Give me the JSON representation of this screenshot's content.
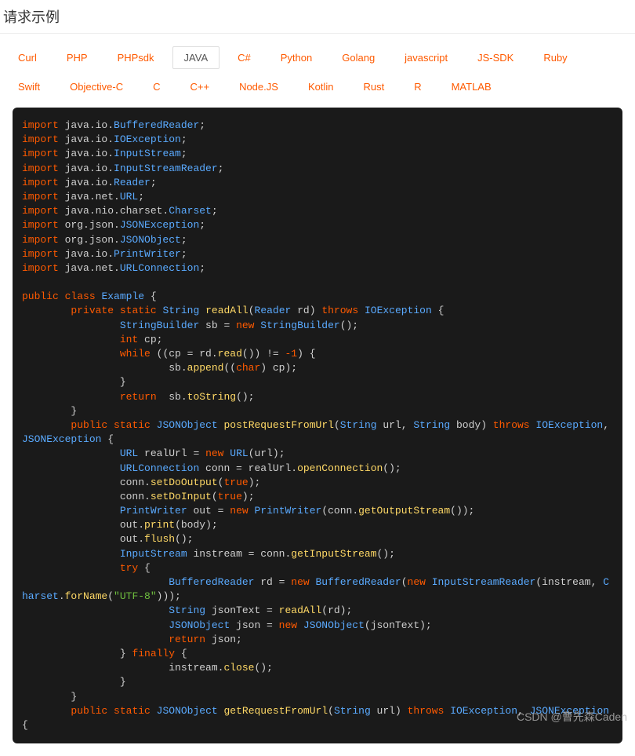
{
  "header": {
    "title": "请求示例"
  },
  "tabs": {
    "items": [
      {
        "label": "Curl"
      },
      {
        "label": "PHP"
      },
      {
        "label": "PHPsdk"
      },
      {
        "label": "JAVA",
        "active": true
      },
      {
        "label": "C#"
      },
      {
        "label": "Python"
      },
      {
        "label": "Golang"
      },
      {
        "label": "javascript"
      },
      {
        "label": "JS-SDK"
      },
      {
        "label": "Ruby"
      },
      {
        "label": "Swift"
      },
      {
        "label": "Objective-C"
      },
      {
        "label": "C"
      },
      {
        "label": "C++"
      },
      {
        "label": "Node.JS"
      },
      {
        "label": "Kotlin"
      },
      {
        "label": "Rust"
      },
      {
        "label": "R"
      },
      {
        "label": "MATLAB"
      }
    ]
  },
  "code": {
    "tokens": [
      [
        "kw",
        "import"
      ],
      [
        "pln",
        " java.io."
      ],
      [
        "typ",
        "BufferedReader"
      ],
      [
        "pln",
        ";\n"
      ],
      [
        "kw",
        "import"
      ],
      [
        "pln",
        " java.io."
      ],
      [
        "typ",
        "IOException"
      ],
      [
        "pln",
        ";\n"
      ],
      [
        "kw",
        "import"
      ],
      [
        "pln",
        " java.io."
      ],
      [
        "typ",
        "InputStream"
      ],
      [
        "pln",
        ";\n"
      ],
      [
        "kw",
        "import"
      ],
      [
        "pln",
        " java.io."
      ],
      [
        "typ",
        "InputStreamReader"
      ],
      [
        "pln",
        ";\n"
      ],
      [
        "kw",
        "import"
      ],
      [
        "pln",
        " java.io."
      ],
      [
        "typ",
        "Reader"
      ],
      [
        "pln",
        ";\n"
      ],
      [
        "kw",
        "import"
      ],
      [
        "pln",
        " java.net."
      ],
      [
        "typ",
        "URL"
      ],
      [
        "pln",
        ";\n"
      ],
      [
        "kw",
        "import"
      ],
      [
        "pln",
        " java.nio.charset."
      ],
      [
        "typ",
        "Charset"
      ],
      [
        "pln",
        ";\n"
      ],
      [
        "kw",
        "import"
      ],
      [
        "pln",
        " org.json."
      ],
      [
        "typ",
        "JSONException"
      ],
      [
        "pln",
        ";\n"
      ],
      [
        "kw",
        "import"
      ],
      [
        "pln",
        " org.json."
      ],
      [
        "typ",
        "JSONObject"
      ],
      [
        "pln",
        ";\n"
      ],
      [
        "kw",
        "import"
      ],
      [
        "pln",
        " java.io."
      ],
      [
        "typ",
        "PrintWriter"
      ],
      [
        "pln",
        ";\n"
      ],
      [
        "kw",
        "import"
      ],
      [
        "pln",
        " java.net."
      ],
      [
        "typ",
        "URLConnection"
      ],
      [
        "pln",
        ";\n\n"
      ],
      [
        "kw",
        "public"
      ],
      [
        "pln",
        " "
      ],
      [
        "kw",
        "class"
      ],
      [
        "pln",
        " "
      ],
      [
        "typ",
        "Example"
      ],
      [
        "pln",
        " {\n"
      ],
      [
        "pln",
        "        "
      ],
      [
        "kw",
        "private"
      ],
      [
        "pln",
        " "
      ],
      [
        "kw",
        "static"
      ],
      [
        "pln",
        " "
      ],
      [
        "typ",
        "String"
      ],
      [
        "pln",
        " "
      ],
      [
        "mth",
        "readAll"
      ],
      [
        "pln",
        "("
      ],
      [
        "typ",
        "Reader"
      ],
      [
        "pln",
        " rd) "
      ],
      [
        "kw",
        "throws"
      ],
      [
        "pln",
        " "
      ],
      [
        "typ",
        "IOException"
      ],
      [
        "pln",
        " {\n"
      ],
      [
        "pln",
        "                "
      ],
      [
        "typ",
        "StringBuilder"
      ],
      [
        "pln",
        " sb = "
      ],
      [
        "kw",
        "new"
      ],
      [
        "pln",
        " "
      ],
      [
        "typ",
        "StringBuilder"
      ],
      [
        "pln",
        "();\n"
      ],
      [
        "pln",
        "                "
      ],
      [
        "kw",
        "int"
      ],
      [
        "pln",
        " cp;\n"
      ],
      [
        "pln",
        "                "
      ],
      [
        "kw",
        "while"
      ],
      [
        "pln",
        " ((cp = rd."
      ],
      [
        "mth",
        "read"
      ],
      [
        "pln",
        "()) != "
      ],
      [
        "num",
        "-1"
      ],
      [
        "pln",
        ") {\n"
      ],
      [
        "pln",
        "                        sb."
      ],
      [
        "mth",
        "append"
      ],
      [
        "pln",
        "(("
      ],
      [
        "kw",
        "char"
      ],
      [
        "pln",
        ") cp);\n"
      ],
      [
        "pln",
        "                }\n"
      ],
      [
        "pln",
        "                "
      ],
      [
        "kw",
        "return"
      ],
      [
        "pln",
        "  sb."
      ],
      [
        "mth",
        "toString"
      ],
      [
        "pln",
        "();\n"
      ],
      [
        "pln",
        "        }\n"
      ],
      [
        "pln",
        "        "
      ],
      [
        "kw",
        "public"
      ],
      [
        "pln",
        " "
      ],
      [
        "kw",
        "static"
      ],
      [
        "pln",
        " "
      ],
      [
        "typ",
        "JSONObject"
      ],
      [
        "pln",
        " "
      ],
      [
        "mth",
        "postRequestFromUrl"
      ],
      [
        "pln",
        "("
      ],
      [
        "typ",
        "String"
      ],
      [
        "pln",
        " url, "
      ],
      [
        "typ",
        "String"
      ],
      [
        "pln",
        " body) "
      ],
      [
        "kw",
        "throws"
      ],
      [
        "pln",
        " "
      ],
      [
        "typ",
        "IOException"
      ],
      [
        "pln",
        ", "
      ],
      [
        "typ",
        "JSONException"
      ],
      [
        "pln",
        " {\n"
      ],
      [
        "pln",
        "                "
      ],
      [
        "typ",
        "URL"
      ],
      [
        "pln",
        " realUrl = "
      ],
      [
        "kw",
        "new"
      ],
      [
        "pln",
        " "
      ],
      [
        "typ",
        "URL"
      ],
      [
        "pln",
        "(url);\n"
      ],
      [
        "pln",
        "                "
      ],
      [
        "typ",
        "URLConnection"
      ],
      [
        "pln",
        " conn = realUrl."
      ],
      [
        "mth",
        "openConnection"
      ],
      [
        "pln",
        "();\n"
      ],
      [
        "pln",
        "                conn."
      ],
      [
        "mth",
        "setDoOutput"
      ],
      [
        "pln",
        "("
      ],
      [
        "kw",
        "true"
      ],
      [
        "pln",
        ");\n"
      ],
      [
        "pln",
        "                conn."
      ],
      [
        "mth",
        "setDoInput"
      ],
      [
        "pln",
        "("
      ],
      [
        "kw",
        "true"
      ],
      [
        "pln",
        ");\n"
      ],
      [
        "pln",
        "                "
      ],
      [
        "typ",
        "PrintWriter"
      ],
      [
        "pln",
        " out = "
      ],
      [
        "kw",
        "new"
      ],
      [
        "pln",
        " "
      ],
      [
        "typ",
        "PrintWriter"
      ],
      [
        "pln",
        "(conn."
      ],
      [
        "mth",
        "getOutputStream"
      ],
      [
        "pln",
        "());\n"
      ],
      [
        "pln",
        "                out."
      ],
      [
        "mth",
        "print"
      ],
      [
        "pln",
        "(body);\n"
      ],
      [
        "pln",
        "                out."
      ],
      [
        "mth",
        "flush"
      ],
      [
        "pln",
        "();\n"
      ],
      [
        "pln",
        "                "
      ],
      [
        "typ",
        "InputStream"
      ],
      [
        "pln",
        " instream = conn."
      ],
      [
        "mth",
        "getInputStream"
      ],
      [
        "pln",
        "();\n"
      ],
      [
        "pln",
        "                "
      ],
      [
        "kw",
        "try"
      ],
      [
        "pln",
        " {\n"
      ],
      [
        "pln",
        "                        "
      ],
      [
        "typ",
        "BufferedReader"
      ],
      [
        "pln",
        " rd = "
      ],
      [
        "kw",
        "new"
      ],
      [
        "pln",
        " "
      ],
      [
        "typ",
        "BufferedReader"
      ],
      [
        "pln",
        "("
      ],
      [
        "kw",
        "new"
      ],
      [
        "pln",
        " "
      ],
      [
        "typ",
        "InputStreamReader"
      ],
      [
        "pln",
        "(instream, "
      ],
      [
        "typ",
        "Charset"
      ],
      [
        "pln",
        "."
      ],
      [
        "mth",
        "forName"
      ],
      [
        "pln",
        "("
      ],
      [
        "str",
        "\"UTF-8\""
      ],
      [
        "pln",
        ")));\n"
      ],
      [
        "pln",
        "                        "
      ],
      [
        "typ",
        "String"
      ],
      [
        "pln",
        " jsonText = "
      ],
      [
        "mth",
        "readAll"
      ],
      [
        "pln",
        "(rd);\n"
      ],
      [
        "pln",
        "                        "
      ],
      [
        "typ",
        "JSONObject"
      ],
      [
        "pln",
        " json = "
      ],
      [
        "kw",
        "new"
      ],
      [
        "pln",
        " "
      ],
      [
        "typ",
        "JSONObject"
      ],
      [
        "pln",
        "(jsonText);\n"
      ],
      [
        "pln",
        "                        "
      ],
      [
        "kw",
        "return"
      ],
      [
        "pln",
        " json;\n"
      ],
      [
        "pln",
        "                } "
      ],
      [
        "kw",
        "finally"
      ],
      [
        "pln",
        " {\n"
      ],
      [
        "pln",
        "                        instream."
      ],
      [
        "mth",
        "close"
      ],
      [
        "pln",
        "();\n"
      ],
      [
        "pln",
        "                }\n"
      ],
      [
        "pln",
        "        }\n"
      ],
      [
        "pln",
        "        "
      ],
      [
        "kw",
        "public"
      ],
      [
        "pln",
        " "
      ],
      [
        "kw",
        "static"
      ],
      [
        "pln",
        " "
      ],
      [
        "typ",
        "JSONObject"
      ],
      [
        "pln",
        " "
      ],
      [
        "mth",
        "getRequestFromUrl"
      ],
      [
        "pln",
        "("
      ],
      [
        "typ",
        "String"
      ],
      [
        "pln",
        " url) "
      ],
      [
        "kw",
        "throws"
      ],
      [
        "pln",
        " "
      ],
      [
        "typ",
        "IOException"
      ],
      [
        "pln",
        ", "
      ],
      [
        "typ",
        "JSONException"
      ],
      [
        "pln",
        " {"
      ]
    ]
  },
  "watermark": {
    "text": "CSDN @曹先森Caden"
  }
}
